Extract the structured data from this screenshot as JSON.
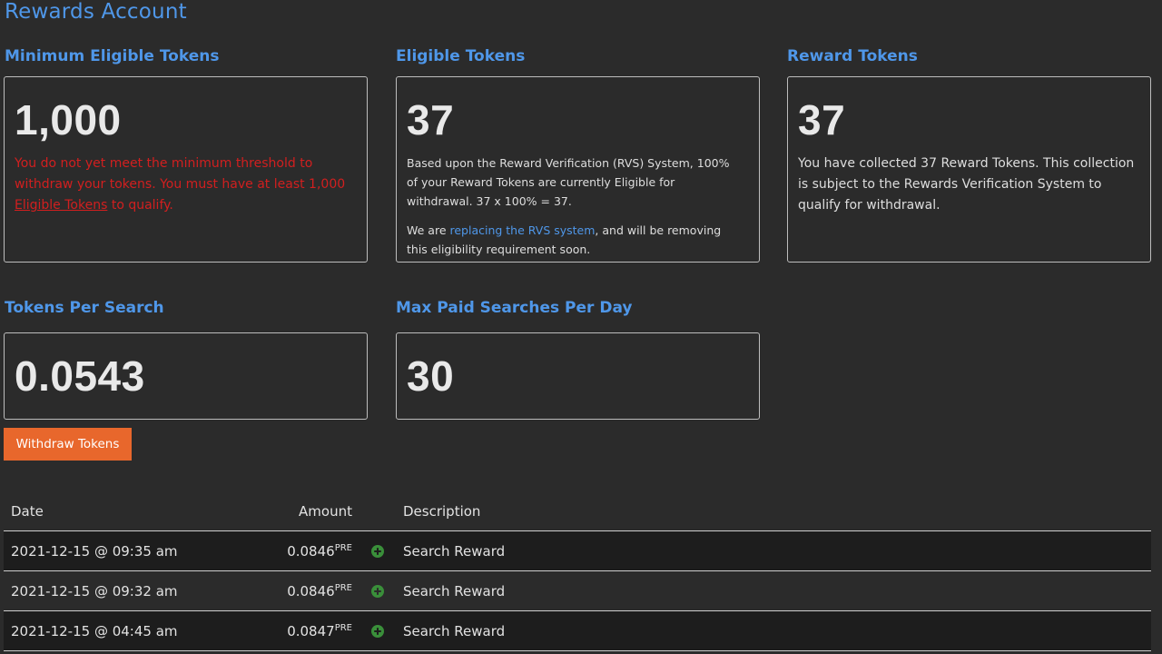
{
  "page": {
    "title": "Rewards Account"
  },
  "cards": {
    "minimum": {
      "title": "Minimum Eligible Tokens",
      "value": "1,000",
      "warning_prefix": "You do not yet meet the minimum threshold to withdraw your tokens. You must have at least 1,000 ",
      "warning_link": "Eligible Tokens",
      "warning_suffix": " to qualify."
    },
    "eligible": {
      "title": "Eligible Tokens",
      "value": "37",
      "desc": "Based upon the Reward Verification (RVS) System, 100% of your Reward Tokens are currently Eligible for withdrawal. 37 x 100% = 37.",
      "note_prefix": "We are ",
      "note_link": "replacing the RVS system",
      "note_suffix": ", and will be removing this eligibility requirement soon."
    },
    "reward": {
      "title": "Reward Tokens",
      "value": "37",
      "desc": "You have collected 37 Reward Tokens. This collection is subject to the Rewards Verification System to qualify for withdrawal."
    },
    "per_search": {
      "title": "Tokens Per Search",
      "value": "0.0543"
    },
    "max_paid": {
      "title": "Max Paid Searches Per Day",
      "value": "30"
    }
  },
  "actions": {
    "withdraw_label": "Withdraw Tokens"
  },
  "table": {
    "headers": {
      "date": "Date",
      "amount": "Amount",
      "description": "Description"
    },
    "rows": [
      {
        "date": "2021-12-15 @ 09:35 am",
        "amount": "0.0846",
        "unit": "PRE",
        "description": "Search Reward"
      },
      {
        "date": "2021-12-15 @ 09:32 am",
        "amount": "0.0846",
        "unit": "PRE",
        "description": "Search Reward"
      },
      {
        "date": "2021-12-15 @ 04:45 am",
        "amount": "0.0847",
        "unit": "PRE",
        "description": "Search Reward"
      }
    ]
  },
  "colors": {
    "accent": "#4f97e9",
    "warning": "#d21f1f",
    "button": "#e8672c",
    "positive": "#3a8f3a"
  },
  "icons": {
    "row_status": "plus-circle-icon"
  }
}
